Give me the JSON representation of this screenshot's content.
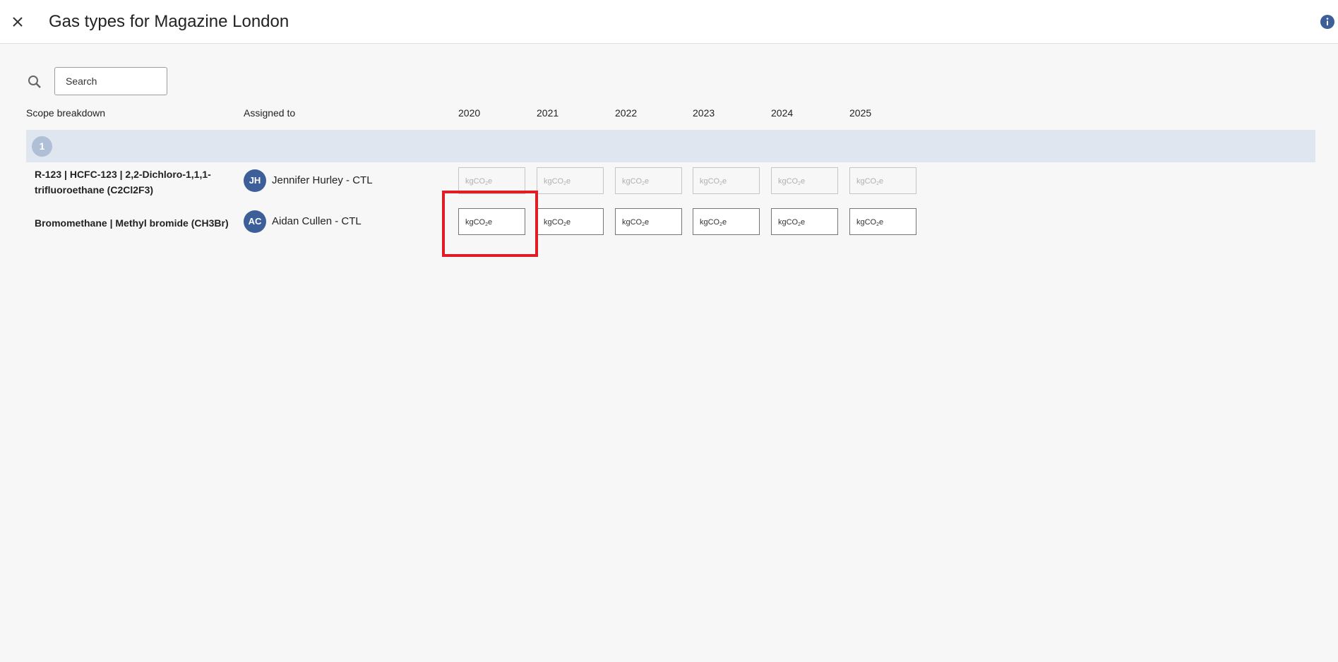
{
  "header": {
    "title": "Gas types for Magazine London"
  },
  "search": {
    "placeholder": "Search"
  },
  "table": {
    "columns": {
      "scope": "Scope breakdown",
      "assigned": "Assigned to",
      "years": [
        "2020",
        "2021",
        "2022",
        "2023",
        "2024",
        "2025"
      ]
    },
    "group": {
      "label": "1"
    },
    "rows": [
      {
        "label_line1": "R-123 | HCFC-123 | 2,2-Dichloro-1,1,1-",
        "label_line2": "trifluoroethane (C2Cl2F3)",
        "initials": "JH",
        "assignee": "Jennifer Hurley - CTL",
        "unit_prefix": "kgCO",
        "unit_sub": "2",
        "unit_suffix": "e",
        "disabled": true
      },
      {
        "label_line1": "Bromomethane | Methyl bromide (CH3Br)",
        "initials": "AC",
        "assignee": "Aidan Cullen - CTL",
        "unit_prefix": "kgCO",
        "unit_sub": "2",
        "unit_suffix": "e",
        "disabled": false
      }
    ]
  },
  "colors": {
    "accent": "#3d5f99",
    "group_row": "#dfe6ef",
    "highlight": "#e01c24"
  }
}
